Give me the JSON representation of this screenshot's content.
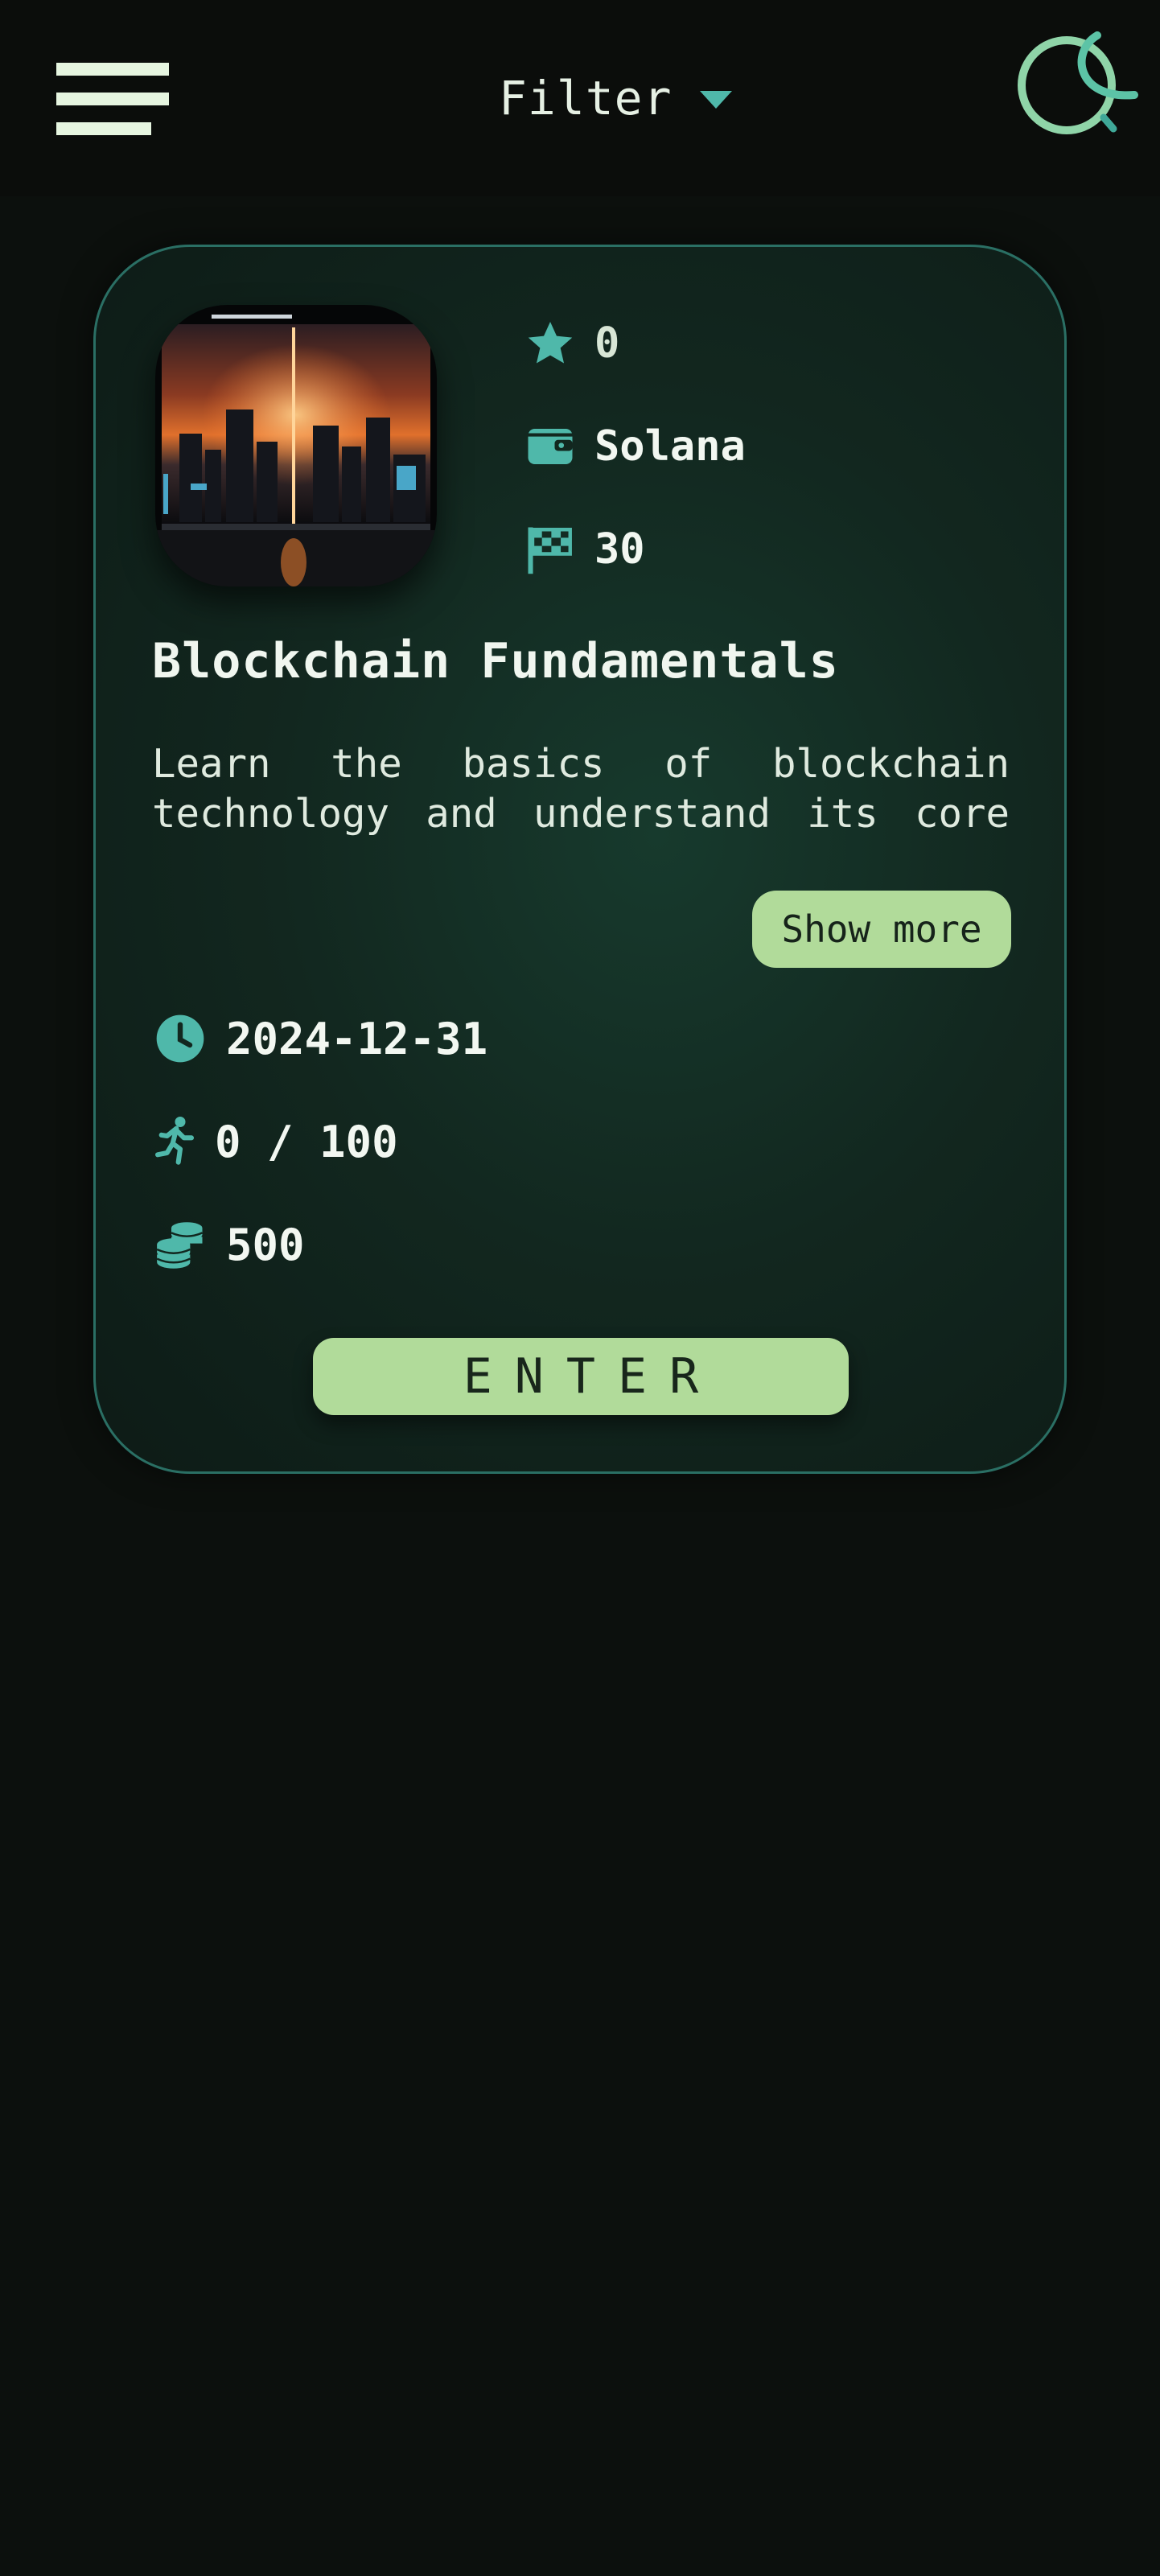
{
  "header": {
    "filter_label": "Filter",
    "menu_icon": "hamburger-menu-icon",
    "logo_icon": "app-logo-icon",
    "caret_icon": "caret-down-icon"
  },
  "colors": {
    "accent_teal": "#4fb8aa",
    "button_green": "#b1db9a",
    "background": "#0c100d"
  },
  "course": {
    "image_icon": "city-sunset-thumbnail",
    "rating": "0",
    "chain": "Solana",
    "level": "30",
    "title": "Blockchain Fundamentals",
    "description": "Learn the basics of blockchain technology and understand its core",
    "show_more_label": "Show more",
    "deadline": "2024-12-31",
    "participants": "0 / 100",
    "reward": "500",
    "enter_label": "ENTER"
  }
}
